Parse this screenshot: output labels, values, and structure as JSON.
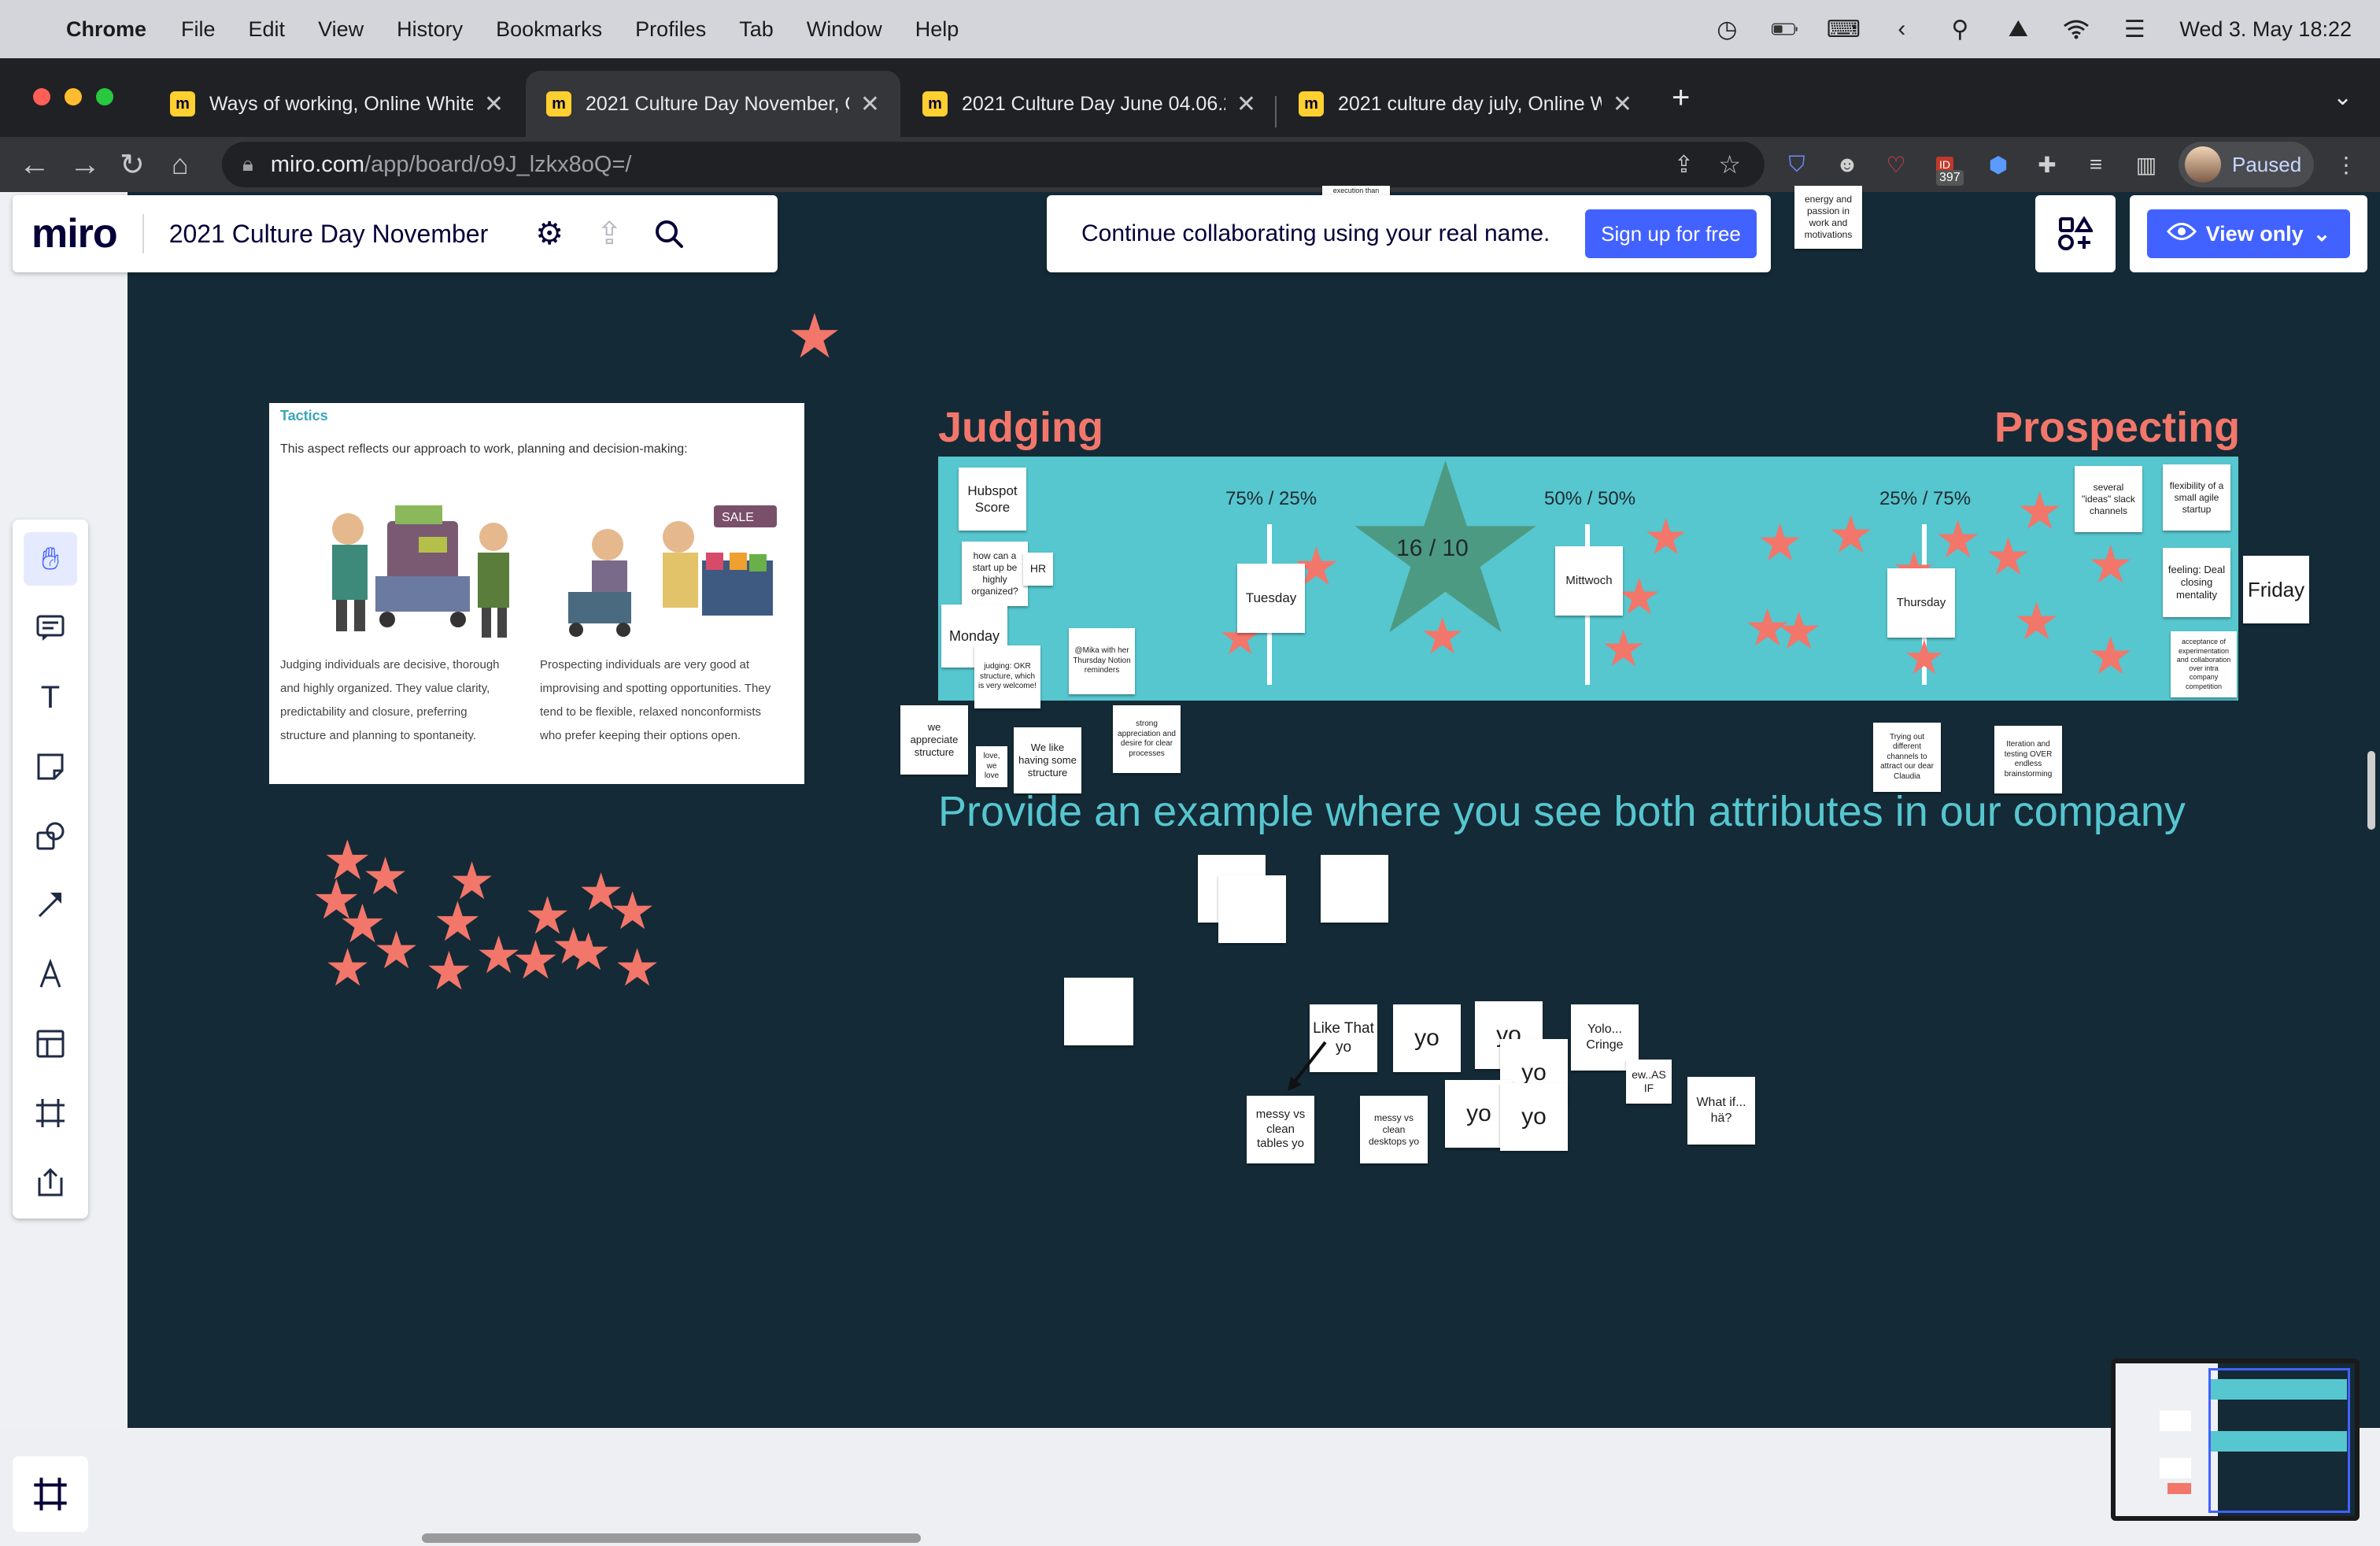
{
  "menubar": {
    "app": "Chrome",
    "items": [
      "File",
      "Edit",
      "View",
      "History",
      "Bookmarks",
      "Profiles",
      "Tab",
      "Window",
      "Help"
    ],
    "datetime": "Wed 3. May  18:22"
  },
  "tabs": [
    {
      "title": "Ways of working, Online Whiteboard"
    },
    {
      "title": "2021 Culture Day November, Online Whiteboard"
    },
    {
      "title": "2021 Culture Day June 04.06.2021"
    },
    {
      "title": "2021 culture day july, Online Whiteboard"
    }
  ],
  "address": {
    "domain": "miro.com",
    "path": "/app/board/o9J_lzkx8oQ=/"
  },
  "extensions": {
    "badge_count": "397",
    "badge_label": "ID"
  },
  "profile": {
    "label": "Paused"
  },
  "miro": {
    "logo": "miro",
    "board_name": "2021 Culture Day November",
    "collab_message": "Continue collaborating using your real name.",
    "signup_label": "Sign up for free",
    "view_only_label": "View only"
  },
  "board": {
    "tactics": {
      "title": "Tactics",
      "subtitle": "This aspect reflects our approach to work, planning and decision-making:",
      "judging_text": "Judging individuals are decisive, thorough and highly organized. They value clarity, predictability and closure, preferring structure and planning to spontaneity.",
      "prospecting_text": "Prospecting individuals are very good at improvising and spotting opportunities. They tend to be flexible, relaxed nonconformists who prefer keeping their options open.",
      "sale_tag": "SALE"
    },
    "judging_label": "Judging",
    "prospecting_label": "Prospecting",
    "ratios": [
      "75% / 25%",
      "50% / 50%",
      "25% / 75%"
    ],
    "score": "16 / 10",
    "prompt": "Provide an example where you see both attributes in our company",
    "stickies": {
      "execution": "execution than",
      "energy": "energy and passion in work and motivations",
      "hubspot": "Hubspot Score",
      "organized": "how can a start up be highly organized?",
      "hr": "HR",
      "monday": "Monday",
      "okr": "judging: OKR structure, which is very welcome!",
      "mika": "@Mika with her Thursday Notion reminders",
      "tuesday": "Tuesday",
      "mittwoch": "Mittwoch",
      "thursday": "Thursday",
      "friday": "Friday",
      "ideas": "several \"ideas\" slack channels",
      "flex": "flexibility of a small agile startup",
      "deal": "feeling: Deal closing mentality",
      "accept": "acceptance of experimentation and collaboration over intra company competition",
      "appreciate": "we appreciate structure",
      "love": "love, we love",
      "havingstructure": "We like having some structure",
      "strong": "strong appreciation and desire for clear processes",
      "trying": "Trying out different channels to attract our dear Claudia",
      "iteration": "Iteration and testing OVER endless brainstorming",
      "like": "Like That yo",
      "yo1": "yo",
      "yo2": "yo",
      "yo3": "yo",
      "yo4": "yo",
      "yo5": "yo",
      "yolo": "Yolo... Cringe",
      "ew": "ew..AS IF",
      "whatif": "What if... hä?",
      "messy": "messy vs clean tables yo",
      "messy2": "messy vs clean desktops yo"
    }
  },
  "colors": {
    "board_bg": "#142a36",
    "accent_coral": "#f2766a",
    "teal": "#56c6cf",
    "star_green": "#4d9a82",
    "miro_blue": "#4262ff"
  }
}
